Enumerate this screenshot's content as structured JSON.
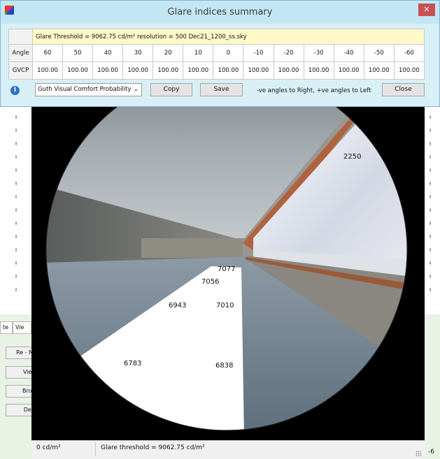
{
  "dialog": {
    "title": "Glare indices summary",
    "close_glyph": "✕",
    "info_line": "Glare Threshold = 9062.75 cd/m²    resolution = 500    Dec21_1200_ss.sky",
    "angle_label": "Angle",
    "gvcp_label": "GVCP",
    "angles": [
      "60",
      "50",
      "40",
      "30",
      "20",
      "10",
      "0",
      "-10",
      "-20",
      "-30",
      "-40",
      "-50",
      "-60"
    ],
    "gvcp_values": [
      "100.00",
      "100.00",
      "100.00",
      "100.00",
      "100.00",
      "100.00",
      "100.00",
      "100.00",
      "100.00",
      "100.00",
      "100.00",
      "100.00",
      "100.00"
    ],
    "metric_select": "Guth Visual Comfort Probability",
    "copy_label": "Copy",
    "save_label": "Save",
    "hint": "-ve angles to Right, +ve angles to Left",
    "close_label": "Close",
    "info_icon_glyph": "i",
    "chevron_glyph": "⌄"
  },
  "image": {
    "glare_labels": [
      "2250",
      "7077",
      "7056",
      "6943",
      "7010",
      "6783",
      "6838"
    ]
  },
  "status": {
    "luminance": "0 cd/m²",
    "threshold": "Glare threshold = 9062.75 cd/m²"
  },
  "background": {
    "tab1": "te",
    "tab2": "Vie",
    "buttons": [
      "Re - Na",
      "View",
      "Brow",
      "Dele"
    ],
    "right_number": "-6"
  },
  "colors": {
    "accent": "#2c6fc6",
    "close_red": "#c95050",
    "info_bg": "#fff9c8",
    "title_bg": "#c4e6f3"
  }
}
